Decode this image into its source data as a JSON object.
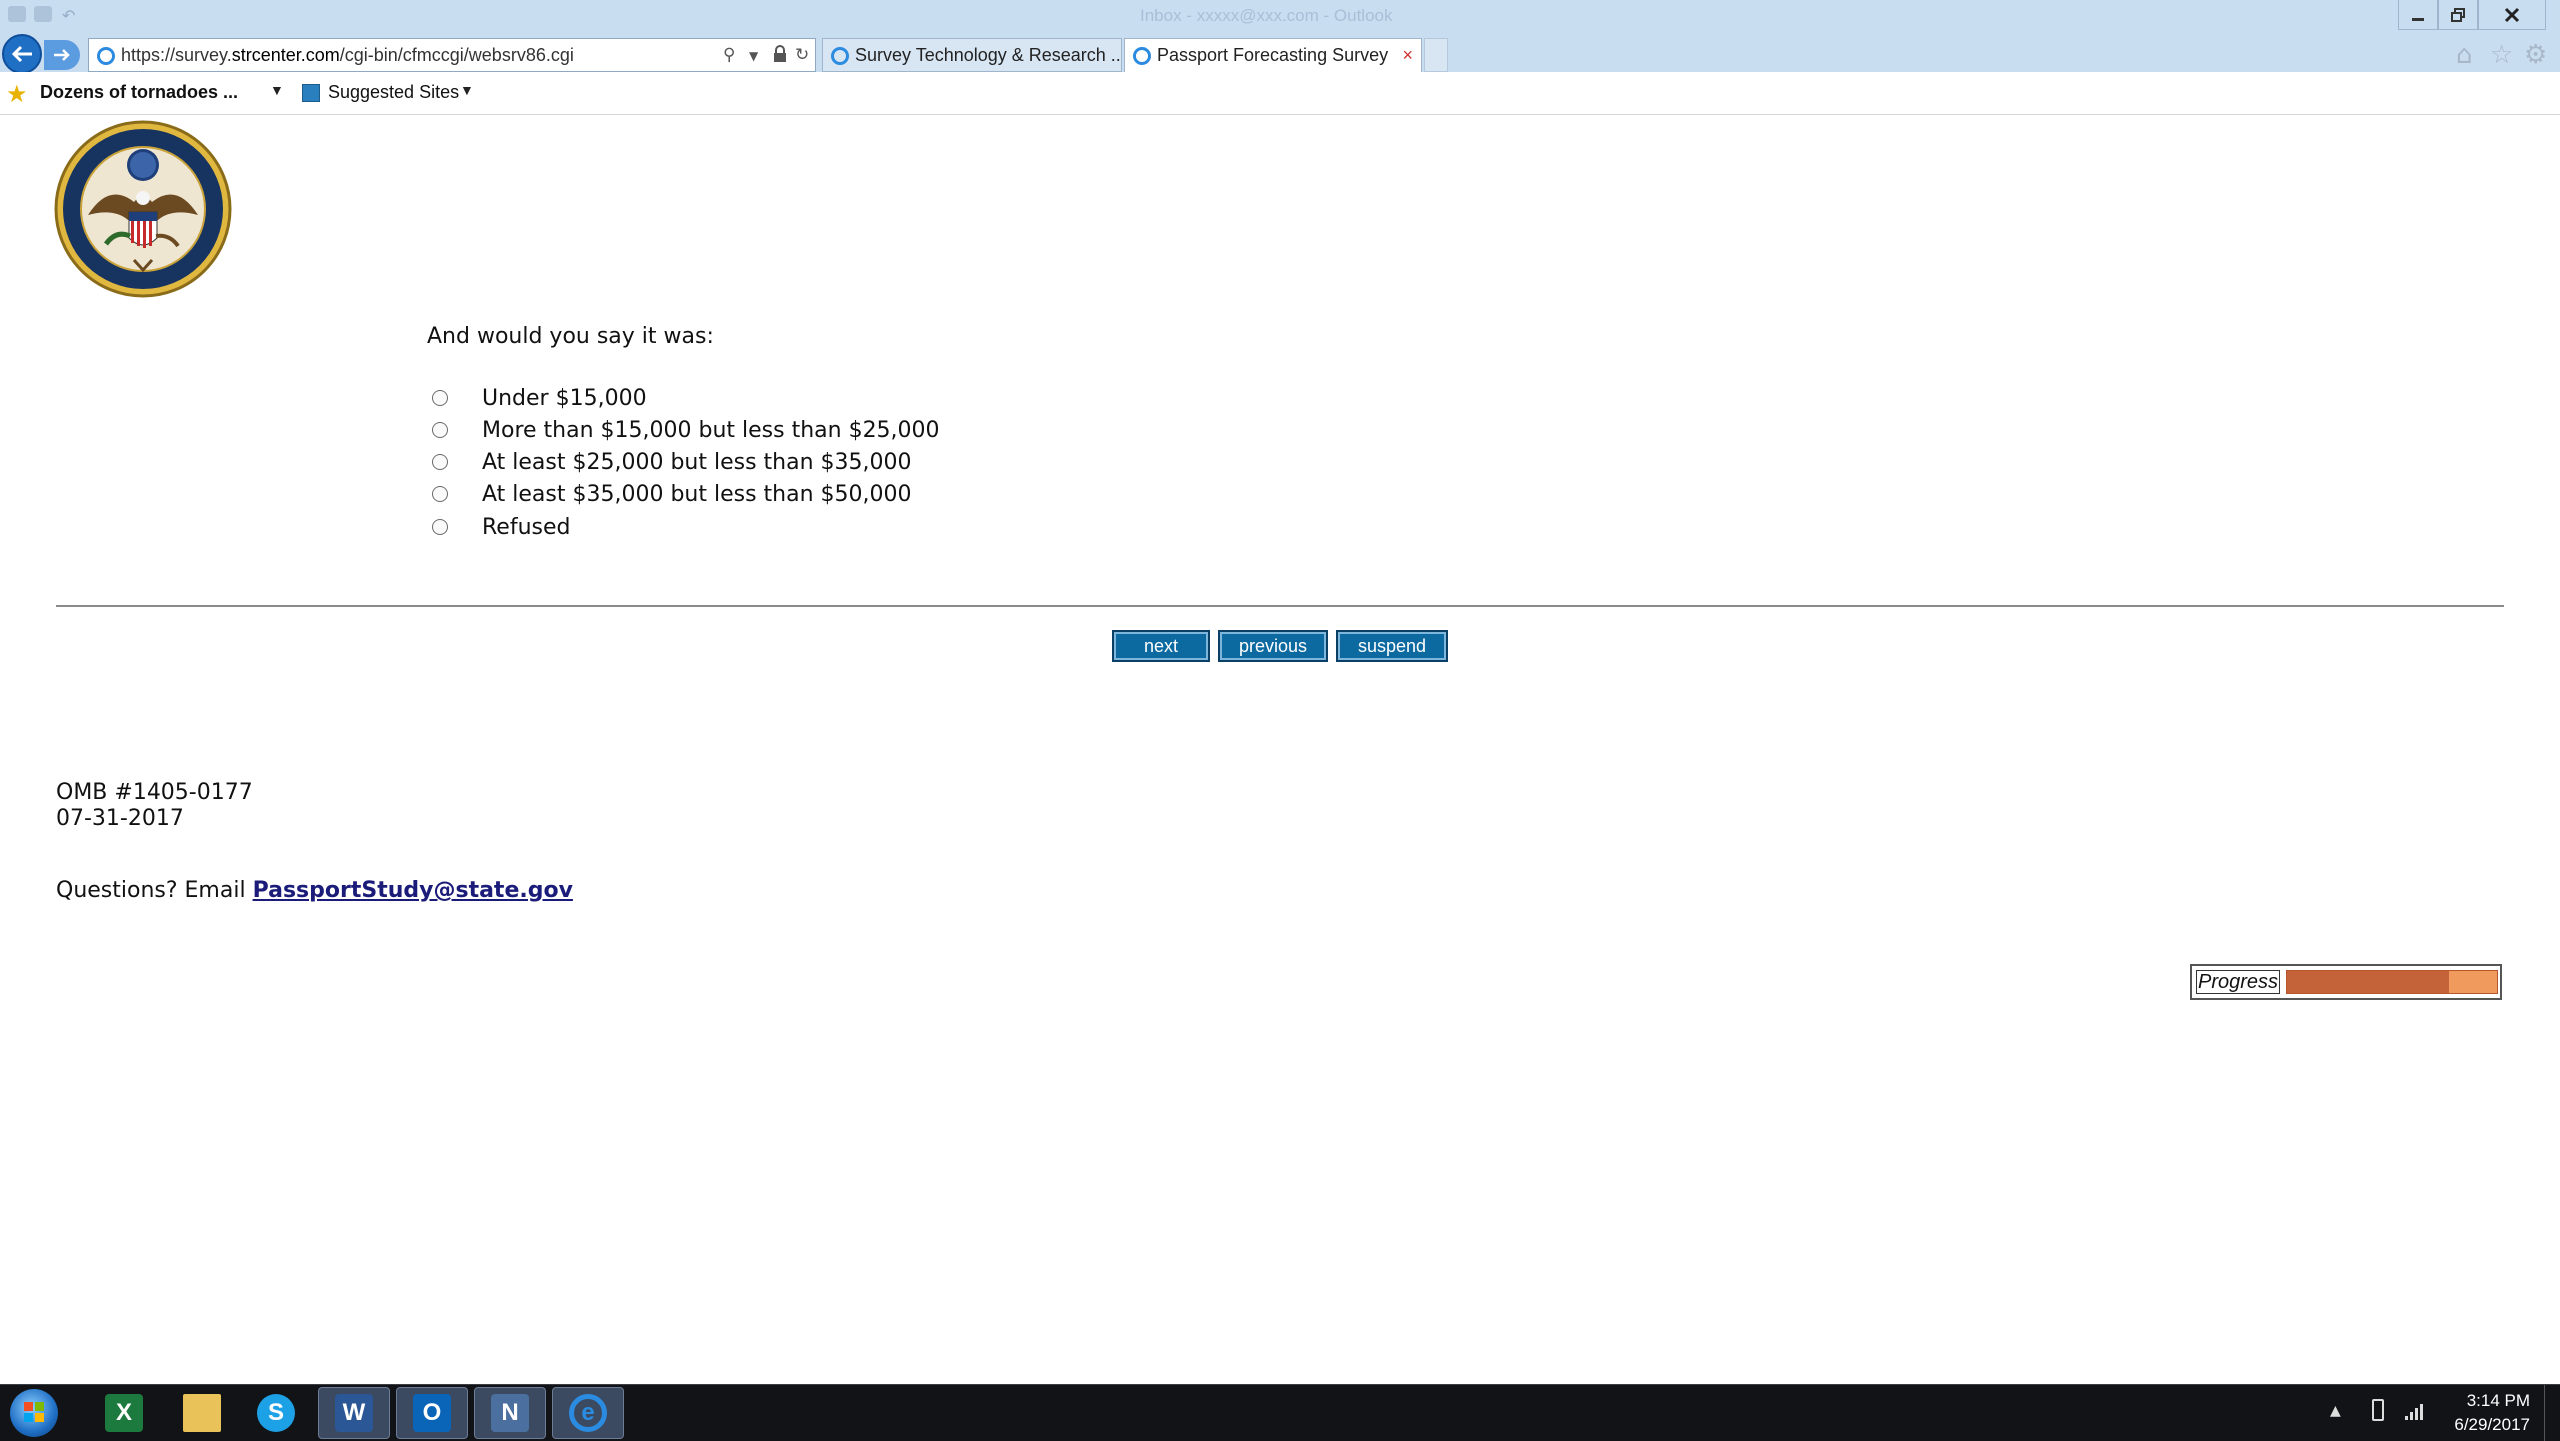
{
  "window": {
    "title": "Inbox - xxxxx@xxx.com - Outlook"
  },
  "browser": {
    "url_prefix": "https://survey.",
    "url_host": "strcenter.com",
    "url_path": "/cgi-bin/cfmccgi/websrv86.cgi",
    "tabs": [
      {
        "label": "Survey Technology & Research ..."
      },
      {
        "label": "Passport Forecasting Survey",
        "close": "×"
      }
    ],
    "favorites": [
      {
        "label": "Dozens of tornadoes ..."
      },
      {
        "label": "Suggested Sites"
      }
    ]
  },
  "survey": {
    "question": "And would you say it was:",
    "options": [
      "Under $15,000",
      "More than $15,000 but less than $25,000",
      "At least $25,000 but less than $35,000",
      "At least $35,000 but less than $50,000",
      "Refused"
    ],
    "buttons": {
      "next": "next",
      "previous": "previous",
      "suspend": "suspend"
    },
    "omb_number": "OMB #1405-0177",
    "omb_date": "07-31-2017",
    "questions_prefix": "Questions? Email ",
    "email": "PassportStudy@state.gov",
    "progress_label": "Progress",
    "progress_fraction": 0.77
  },
  "taskbar": {
    "apps": [
      "excel-icon",
      "file-explorer-icon",
      "skype-icon",
      "word-icon",
      "outlook-icon",
      "nvivo-icon",
      "internet-explorer-icon"
    ],
    "time": "3:14 PM",
    "date": "6/29/2017"
  },
  "colors": {
    "button_bg": "#0d6aa1",
    "progress_fill": "#c4623a",
    "progress_track": "#f09a5e",
    "link": "#1b1b7a"
  }
}
